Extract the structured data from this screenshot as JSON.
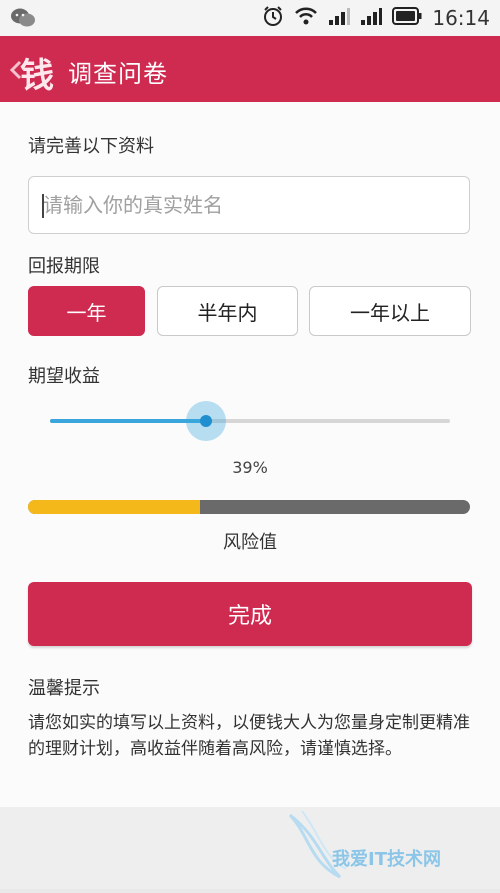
{
  "status": {
    "time": "16:14"
  },
  "header": {
    "title": "调查问卷",
    "back_glyph": "钱"
  },
  "form": {
    "section_title": "请完善以下资料",
    "name_placeholder": "请输入你的真实姓名",
    "period_label": "回报期限",
    "period_options": [
      "一年",
      "半年内",
      "一年以上"
    ],
    "selected_period": "一年",
    "return_label": "期望收益",
    "return_percent_text": "39%",
    "slider_fraction": 0.39,
    "risk_fraction": 0.39,
    "risk_label": "风险值",
    "submit_label": "完成"
  },
  "tips": {
    "title": "温馨提示",
    "text": "请您如实的填写以上资料，以便钱大人为您量身定制更精准的理财计划，高收益伴随着高风险，请谨慎选择。"
  },
  "colors": {
    "accent": "#cf2a50",
    "slider": "#3aa6dc",
    "risk_fill": "#f5b81a"
  },
  "watermark": {
    "text": "我爱IT技术网"
  }
}
